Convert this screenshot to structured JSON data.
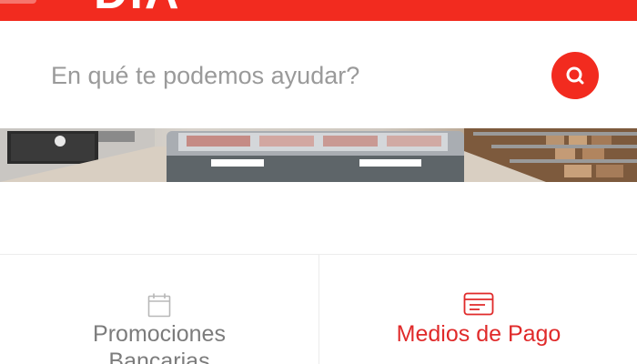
{
  "header": {
    "logo_text": "DIA",
    "brand_color": "#f22b1f"
  },
  "search": {
    "placeholder": "En qué te podemos ayudar?",
    "button_icon": "search-icon"
  },
  "banner": {
    "image_description": "supermarket-freezer-aisle-photo"
  },
  "cards": [
    {
      "label_line1": "Promociones",
      "label_line2": "Bancarias",
      "icon": "calendar-icon",
      "color": "#7c7c7c"
    },
    {
      "label_line1": "Medios de Pago",
      "icon": "credit-card-icon",
      "color": "#e02a2a"
    }
  ]
}
